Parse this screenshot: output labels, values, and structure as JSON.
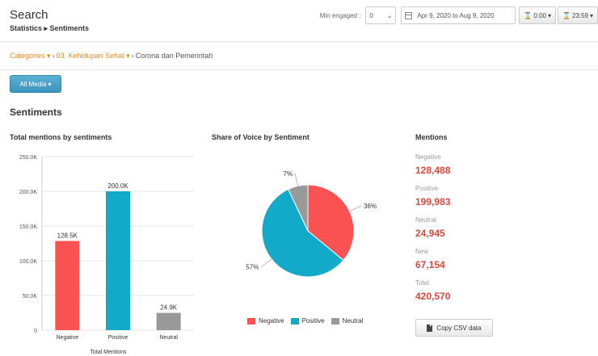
{
  "header": {
    "title": "Search",
    "breadcrumb": "Statistics ▸ Sentiments",
    "min_engaged_label": "Min engaged :",
    "min_engaged_value": "0",
    "date_range": "Apr 9, 2020 to Aug 9, 2020",
    "start_time": "0:00",
    "end_time": "23:59"
  },
  "filter": {
    "categories": "Categories",
    "subcategory": "03. Kehidupan Sehat",
    "current": "Corona dan Pemerintah"
  },
  "media_button": "All Media",
  "section_title": "Sentiments",
  "bar_chart_title": "Total mentions by sentiments",
  "pie_chart_title": "Share of Voice by Sentiment",
  "mentions": {
    "title": "Mentions",
    "items": [
      {
        "label": "Negative",
        "value": "128,488"
      },
      {
        "label": "Positive",
        "value": "199,983"
      },
      {
        "label": "Neutral",
        "value": "24,945"
      },
      {
        "label": "New",
        "value": "67,154"
      },
      {
        "label": "Total",
        "value": "420,570"
      }
    ],
    "csv_button": "Copy CSV data"
  },
  "colors": {
    "negative": "#fa5252",
    "positive": "#13a9c8",
    "neutral": "#999999",
    "accent": "#e8881f",
    "button": "#3c94bd"
  },
  "chart_data": [
    {
      "type": "bar",
      "title": "Total mentions by sentiments",
      "categories": [
        "Negative",
        "Positive",
        "Neutral"
      ],
      "values": [
        128500,
        200000,
        24900
      ],
      "data_labels": [
        "128.5K",
        "200.0K",
        "24.9K"
      ],
      "xlabel": "Total Mentions",
      "ylabel": "",
      "ylim": [
        0,
        250000
      ],
      "yticks": [
        0,
        50000,
        100000,
        150000,
        200000,
        250000
      ],
      "ytick_labels": [
        "0",
        "50.0K",
        "100.0K",
        "150.0K",
        "200.0K",
        "250.0K"
      ],
      "grid": true
    },
    {
      "type": "pie",
      "title": "Share of Voice by Sentiment",
      "categories": [
        "Negative",
        "Positive",
        "Neutral"
      ],
      "values": [
        36,
        57,
        7
      ],
      "data_labels": [
        "36%",
        "57%",
        "7%"
      ],
      "legend": "bottom"
    }
  ]
}
